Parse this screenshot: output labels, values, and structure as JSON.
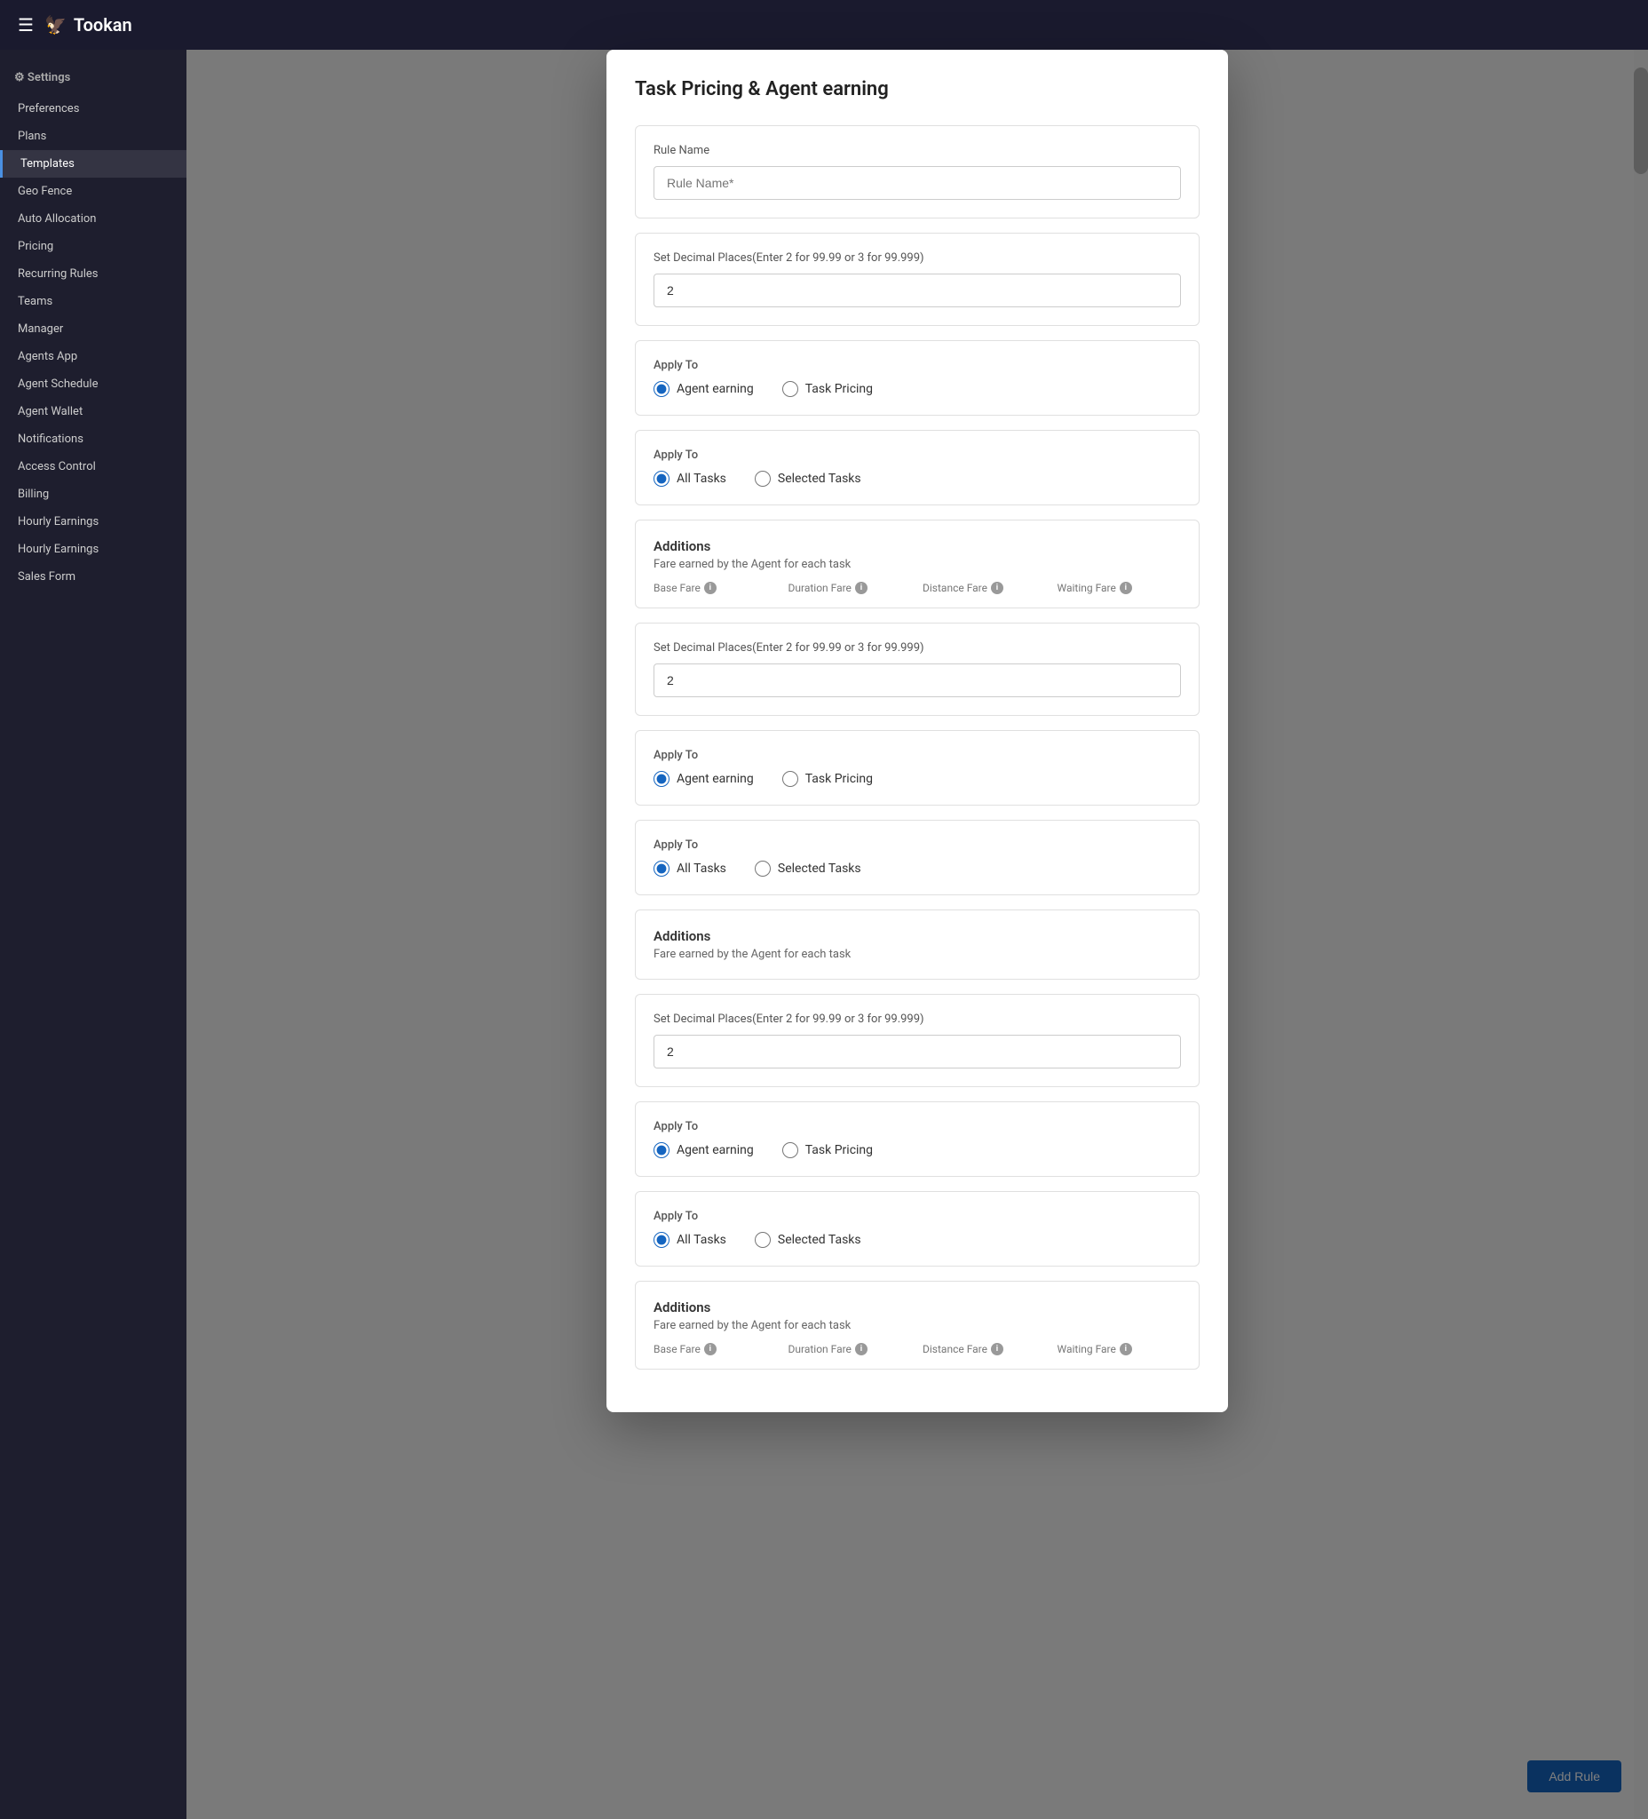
{
  "app": {
    "header": {
      "logo": "Tookan",
      "hamburger": "☰",
      "logo_icon": "🦅"
    },
    "sidebar": {
      "section_label": "Settings",
      "items": [
        {
          "label": "Preferences",
          "active": false
        },
        {
          "label": "Plans",
          "active": false
        },
        {
          "label": "Templates",
          "active": true
        },
        {
          "label": "Geo Fence",
          "active": false
        },
        {
          "label": "Auto Allocation",
          "active": false
        },
        {
          "label": "Pricing",
          "active": false
        },
        {
          "label": "Recurring Rules",
          "active": false
        },
        {
          "label": "Teams",
          "active": false
        },
        {
          "label": "Manager",
          "active": false
        },
        {
          "label": "Agents App",
          "active": false
        },
        {
          "label": "Agent Schedule",
          "active": false
        },
        {
          "label": "Agent Wallet",
          "active": false
        },
        {
          "label": "Notifications",
          "active": false
        },
        {
          "label": "Access Control",
          "active": false
        },
        {
          "label": "Billing",
          "active": false
        },
        {
          "label": "Hourly Earnings",
          "active": false
        },
        {
          "label": "Hourly Earnings",
          "active": false
        },
        {
          "label": "Sales Form",
          "active": false
        }
      ]
    }
  },
  "modal": {
    "title": "Task Pricing & Agent earning",
    "sections": [
      {
        "id": "rule-name",
        "label": "Rule Name",
        "input_placeholder": "Rule Name*",
        "input_value": ""
      },
      {
        "id": "decimal-1",
        "label": "Set Decimal Places(Enter 2 for 99.99 or 3 for 99.999)",
        "input_value": "2"
      },
      {
        "id": "apply-to-type-1",
        "label": "Apply To",
        "options": [
          {
            "label": "Agent earning",
            "value": "agent_earning",
            "checked": true
          },
          {
            "label": "Task Pricing",
            "value": "task_pricing",
            "checked": false
          }
        ]
      },
      {
        "id": "apply-to-tasks-1",
        "label": "Apply To",
        "options": [
          {
            "label": "All Tasks",
            "value": "all_tasks",
            "checked": true
          },
          {
            "label": "Selected Tasks",
            "value": "selected_tasks",
            "checked": false
          }
        ]
      },
      {
        "id": "additions-1",
        "title": "Additions",
        "subtitle": "Fare earned by the Agent for each task",
        "fare_columns": [
          {
            "label": "Base Fare"
          },
          {
            "label": "Duration Fare"
          },
          {
            "label": "Distance Fare"
          },
          {
            "label": "Waiting Fare"
          }
        ]
      },
      {
        "id": "decimal-2",
        "label": "Set Decimal Places(Enter 2 for 99.99 or 3 for 99.999)",
        "input_value": "2"
      },
      {
        "id": "apply-to-type-2",
        "label": "Apply To",
        "options": [
          {
            "label": "Agent earning",
            "value": "agent_earning",
            "checked": true
          },
          {
            "label": "Task Pricing",
            "value": "task_pricing",
            "checked": false
          }
        ]
      },
      {
        "id": "apply-to-tasks-2",
        "label": "Apply To",
        "options": [
          {
            "label": "All Tasks",
            "value": "all_tasks",
            "checked": true
          },
          {
            "label": "Selected Tasks",
            "value": "selected_tasks",
            "checked": false
          }
        ]
      },
      {
        "id": "additions-2",
        "title": "Additions",
        "subtitle": "Fare earned by the Agent for each task"
      },
      {
        "id": "decimal-3",
        "label": "Set Decimal Places(Enter 2 for 99.99 or 3 for 99.999)",
        "input_value": "2"
      },
      {
        "id": "apply-to-type-3",
        "label": "Apply To",
        "options": [
          {
            "label": "Agent earning",
            "value": "agent_earning",
            "checked": true
          },
          {
            "label": "Task Pricing",
            "value": "task_pricing",
            "checked": false
          }
        ]
      },
      {
        "id": "apply-to-tasks-3",
        "label": "Apply To",
        "options": [
          {
            "label": "All Tasks",
            "value": "all_tasks",
            "checked": true
          },
          {
            "label": "Selected Tasks",
            "value": "selected_tasks",
            "checked": false
          }
        ]
      },
      {
        "id": "additions-3",
        "title": "Additions",
        "subtitle": "Fare earned by the Agent for each task",
        "fare_columns": [
          {
            "label": "Base Fare"
          },
          {
            "label": "Duration Fare"
          },
          {
            "label": "Distance Fare"
          },
          {
            "label": "Waiting Fare"
          }
        ]
      }
    ],
    "add_button_label": "Add Rule"
  },
  "icons": {
    "info": "i",
    "delete": "🗑",
    "hamburger": "☰"
  },
  "colors": {
    "primary": "#1565c0",
    "accent": "#4a90e2",
    "radio_active": "#1565c0",
    "border": "#e0e0e0"
  }
}
